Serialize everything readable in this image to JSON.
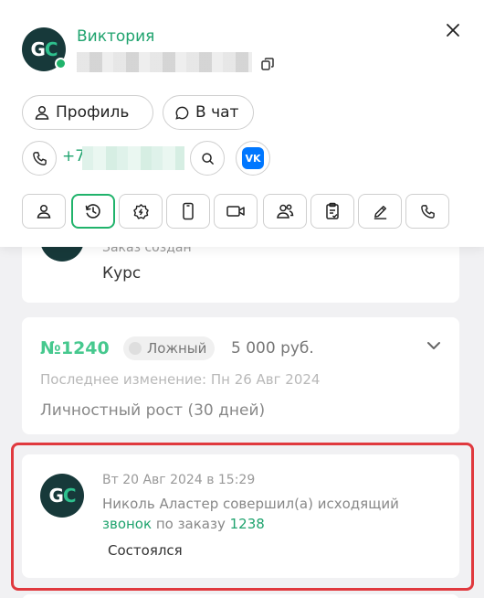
{
  "contact": {
    "name": "Виктория",
    "phone_prefix": "+7",
    "avatar_text_g": "G",
    "avatar_text_c": "C"
  },
  "actions": {
    "profile_label": "Профиль",
    "chat_label": "В чат",
    "vk_label": "VK"
  },
  "tabs": [
    {
      "icon": "person-icon",
      "active": false
    },
    {
      "icon": "history-icon",
      "active": true
    },
    {
      "icon": "gear-badge-icon",
      "active": false
    },
    {
      "icon": "mobile-icon",
      "active": false
    },
    {
      "icon": "video-camera-icon",
      "active": false
    },
    {
      "icon": "people-icon",
      "active": false
    },
    {
      "icon": "clipboard-icon",
      "active": false
    },
    {
      "icon": "pencil-icon",
      "active": false
    },
    {
      "icon": "phone-icon",
      "active": false
    }
  ],
  "feed": {
    "order_created": {
      "subtitle": "Заказ создан",
      "title": "Курс"
    },
    "order": {
      "number": "№1240",
      "status": "Ложный",
      "price": "5 000 руб.",
      "modified": "Последнее изменение: Пн 26 Авг 2024",
      "product": "Личностный рост (30 дней)"
    },
    "call_event": {
      "date": "Вт 20 Авг 2024 в 15:29",
      "line1": "Николь Аластер совершил(а) исходящий",
      "call_link": "звонок",
      "by_order": " по заказу ",
      "order_link": "1238",
      "status": "Состоялся"
    }
  },
  "colors": {
    "accent": "#1fa36e",
    "avatar_bg": "#17393a",
    "highlight": "#e0393e",
    "vk": "#0077ff"
  }
}
